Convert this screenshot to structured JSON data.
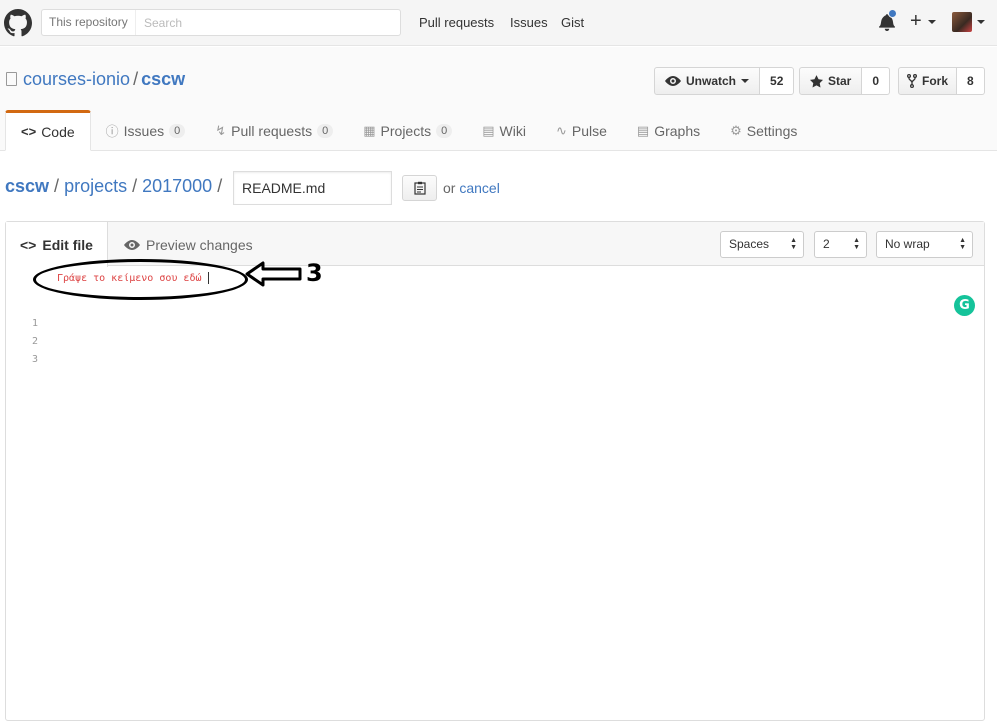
{
  "header": {
    "scope_label": "This repository",
    "search_placeholder": "Search",
    "nav": [
      "Pull requests",
      "Issues",
      "Gist"
    ]
  },
  "repo": {
    "owner": "courses-ionio",
    "separator": "/",
    "name": "cscw",
    "unwatch_label": "Unwatch",
    "watch_count": "52",
    "star_label": "Star",
    "star_count": "0",
    "fork_label": "Fork",
    "fork_count": "8"
  },
  "tabs": [
    {
      "label": "Code",
      "icon": "code-icon"
    },
    {
      "label": "Issues",
      "icon": "issue-icon",
      "count": "0"
    },
    {
      "label": "Pull requests",
      "icon": "pr-icon",
      "count": "0"
    },
    {
      "label": "Projects",
      "icon": "project-icon",
      "count": "0"
    },
    {
      "label": "Wiki",
      "icon": "book-icon"
    },
    {
      "label": "Pulse",
      "icon": "pulse-icon"
    },
    {
      "label": "Graphs",
      "icon": "graph-icon"
    },
    {
      "label": "Settings",
      "icon": "gear-icon"
    }
  ],
  "breadcrumb": {
    "root": "cscw",
    "parts": [
      "projects",
      "2017000"
    ],
    "separator": "/",
    "filename": "README.md",
    "or_text": "or",
    "cancel_label": "cancel"
  },
  "editor": {
    "edit_tab": "Edit file",
    "preview_tab": "Preview changes",
    "indent_mode": "Spaces",
    "indent_size": "2",
    "wrap_mode": "No wrap",
    "line_numbers": [
      "1",
      "2",
      "3"
    ],
    "line1_text": "Γράψε το κείμενο σου εδώ"
  },
  "annotation": {
    "number": "3"
  },
  "colors": {
    "link": "#4078c0",
    "tab_accent": "#d26911",
    "grammarly": "#15c39a"
  }
}
